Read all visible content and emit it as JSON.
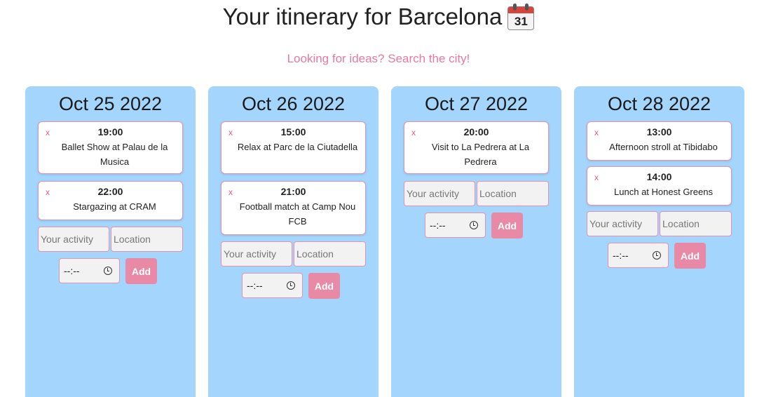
{
  "header": {
    "title": "Your itinerary for Barcelona",
    "calendar_emoji_number": "31",
    "search_link": "Looking for ideas? Search the city!"
  },
  "form": {
    "activity_placeholder": "Your activity",
    "location_placeholder": "Location",
    "time_placeholder": "--:--",
    "add_label": "Add"
  },
  "days": [
    {
      "date": "Oct 25 2022",
      "events": [
        {
          "delete": "x",
          "time": "19:00",
          "title": "Ballet Show at Palau de la Musica"
        },
        {
          "delete": "x",
          "time": "22:00",
          "title": "Stargazing at CRAM"
        }
      ]
    },
    {
      "date": "Oct 26 2022",
      "events": [
        {
          "delete": "x",
          "time": "15:00",
          "title": "Relax at Parc de la Ciutadella"
        },
        {
          "delete": "x",
          "time": "21:00",
          "title": "Football match at Camp Nou FCB"
        }
      ]
    },
    {
      "date": "Oct 27 2022",
      "events": [
        {
          "delete": "x",
          "time": "20:00",
          "title": "Visit to La Pedrera at La Pedrera"
        }
      ]
    },
    {
      "date": "Oct 28 2022",
      "events": [
        {
          "delete": "x",
          "time": "13:00",
          "title": "Afternoon stroll at Tibidabo"
        },
        {
          "delete": "x",
          "time": "14:00",
          "title": "Lunch at Honest Greens"
        }
      ]
    }
  ],
  "colors": {
    "card_background": "#a3d5fd",
    "accent_pink": "#e88aa5",
    "border_pink": "#e392b0",
    "link_pink": "#e8799f"
  }
}
